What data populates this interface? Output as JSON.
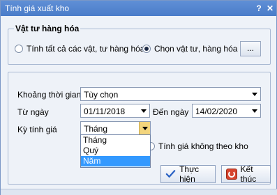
{
  "window": {
    "title": "Tính giá xuất kho",
    "help_label": "?",
    "close_label": "✕"
  },
  "materials_group": {
    "legend": "Vật tư hàng hóa",
    "option_all": "Tính tất cả các vật, tư hàng hóa",
    "option_select": "Chọn vật tư, hàng hóa",
    "selected_option": "option_select",
    "browse_label": "..."
  },
  "period": {
    "range_label": "Khoảng thời gian",
    "range_value": "Tùy chọn",
    "from_label": "Từ ngày",
    "from_value": "01/11/2018",
    "to_label": "Đến ngày",
    "to_value": "14/02/2020",
    "cycle_label": "Kỳ tính giá",
    "cycle_value": "Tháng",
    "cycle_options": [
      "Tháng",
      "Quý",
      "Năm"
    ],
    "highlighted_option": "Năm",
    "no_period_label": "Tính giá không theo kho"
  },
  "actions": {
    "ok_label": "Thực hiện",
    "exit_label": "Kết thúc"
  },
  "colors": {
    "titlebar": "#4a7cc9",
    "highlight": "#3399ff",
    "dropdown_arrow_active": "#f3d57d"
  }
}
